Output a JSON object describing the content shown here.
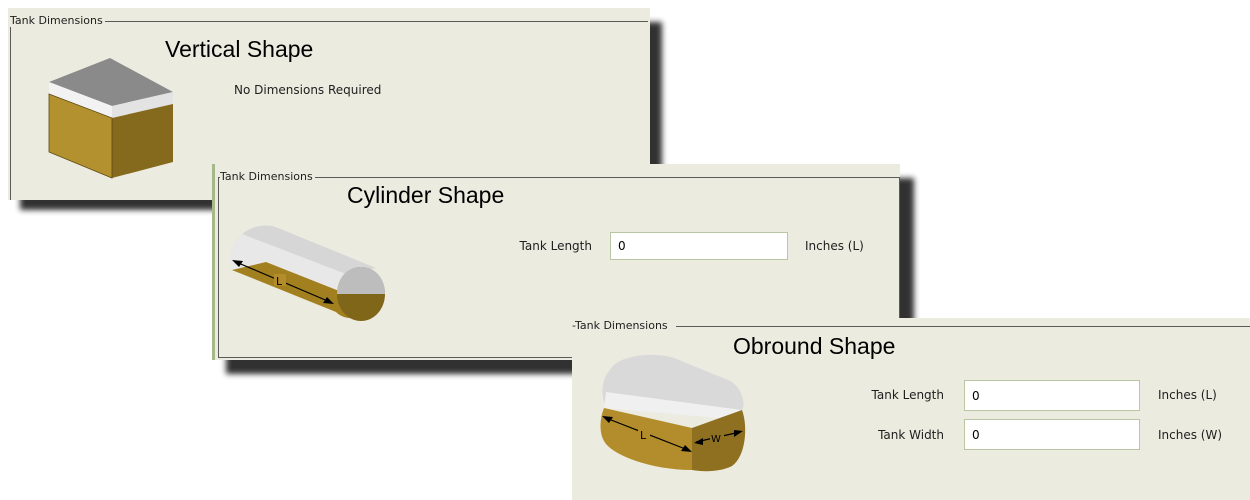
{
  "panels": {
    "vertical": {
      "group_title": "Tank Dimensions",
      "shape_title": "Vertical Shape",
      "note": "No Dimensions Required",
      "icon": "vertical-tank-icon"
    },
    "cylinder": {
      "group_title": "Tank Dimensions",
      "shape_title": "Cylinder Shape",
      "length_label": "Tank Length",
      "length_value": "0",
      "length_unit": "Inches (L)",
      "dim_letter_l": "L",
      "icon": "cylinder-tank-icon"
    },
    "obround": {
      "group_title": "Tank Dimensions",
      "shape_title": "Obround Shape",
      "length_label": "Tank Length",
      "length_value": "0",
      "length_unit": "Inches (L)",
      "width_label": "Tank Width",
      "width_value": "0",
      "width_unit": "Inches (W)",
      "dim_letter_l": "L",
      "dim_letter_w": "W",
      "icon": "obround-tank-icon"
    }
  },
  "colors": {
    "panel_bg": "#ecebdf",
    "tank_fill": "#b28b2d",
    "tank_top": "#bfbfbf"
  }
}
